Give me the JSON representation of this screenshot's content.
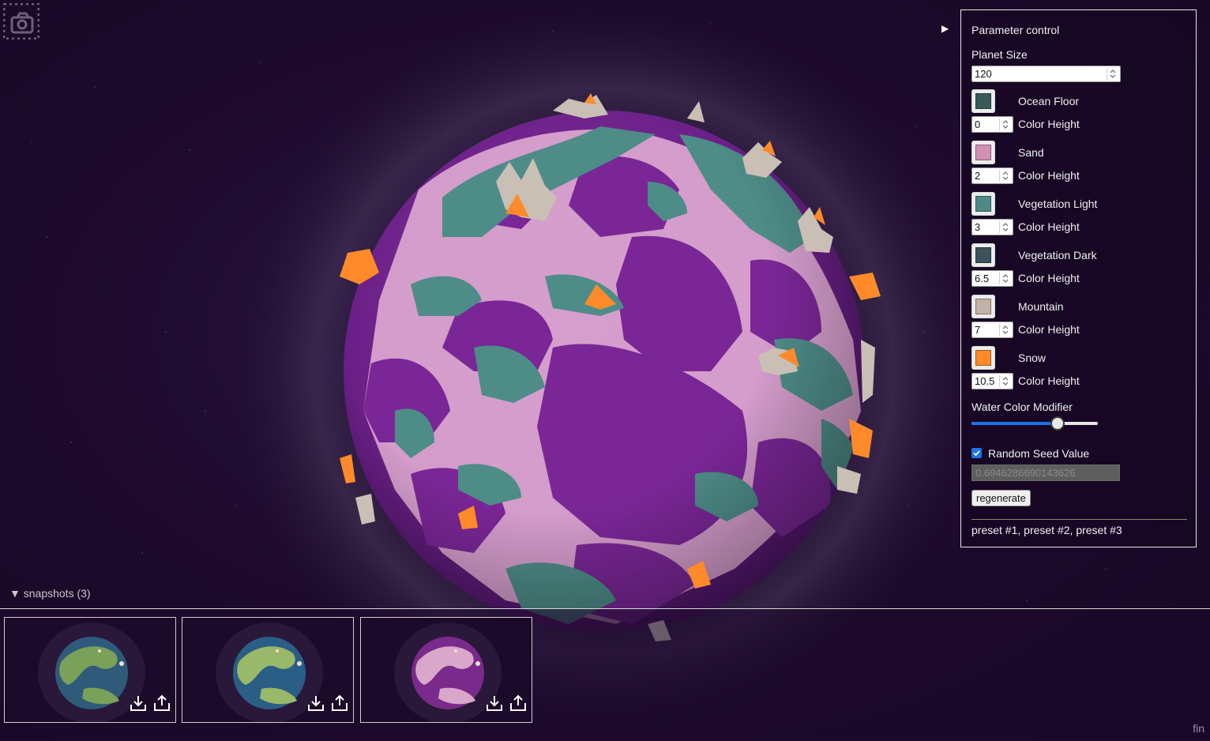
{
  "panel": {
    "toggle_glyph": "▶",
    "title": "Parameter control",
    "planet_size_label": "Planet Size",
    "planet_size_value": "120",
    "color_height_label": "Color Height",
    "layers": [
      {
        "name": "Ocean Floor",
        "color": "#3a5a5a",
        "height": "0"
      },
      {
        "name": "Sand",
        "color": "#d48fb5",
        "height": "2"
      },
      {
        "name": "Vegetation Light",
        "color": "#4d8a86",
        "height": "3"
      },
      {
        "name": "Vegetation Dark",
        "color": "#3a535c",
        "height": "6.5"
      },
      {
        "name": "Mountain",
        "color": "#c2b3a6",
        "height": "7"
      },
      {
        "name": "Snow",
        "color": "#ff8a2a",
        "height": "10.5"
      }
    ],
    "water_modifier_label": "Water Color Modifier",
    "water_modifier_value": 0.68,
    "random_seed_label": "Random Seed Value",
    "random_seed_checked": true,
    "seed_value": "0.6946286690143626",
    "regenerate_label": "regenerate",
    "presets": [
      "preset #1",
      "preset #2",
      "preset #3"
    ],
    "preset_separator": ", "
  },
  "snapshots": {
    "summary": "▼ snapshots (3)",
    "items": [
      {
        "land": "#7aa05a",
        "water": "#2f5a7a"
      },
      {
        "land": "#9ab86a",
        "water": "#2a5e86"
      },
      {
        "land": "#d9a7c9",
        "water": "#7a2a8a"
      }
    ]
  },
  "footer": {
    "text": "fin"
  },
  "icons": {
    "camera": "camera-icon",
    "download": "download-icon",
    "share": "share-icon"
  }
}
